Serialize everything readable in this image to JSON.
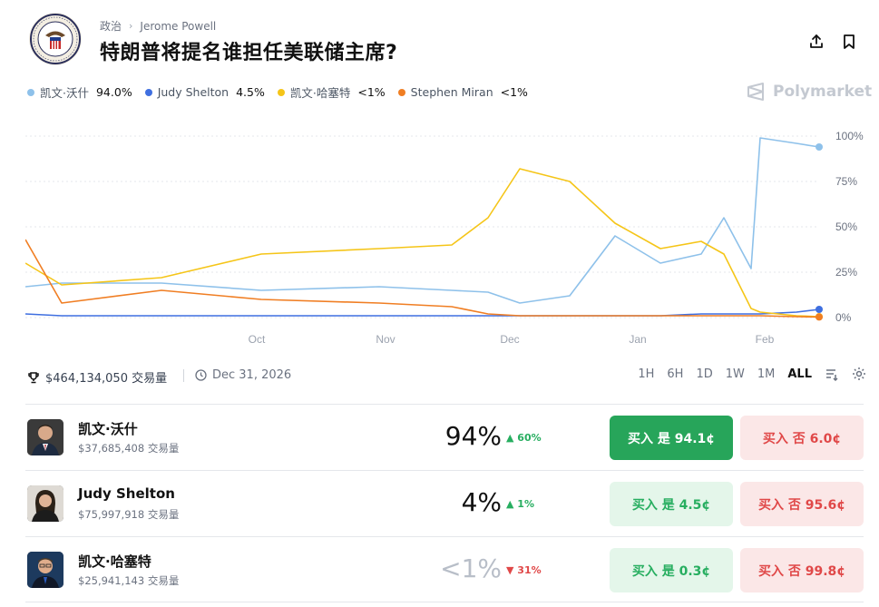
{
  "breadcrumb": {
    "category": "政治",
    "tag": "Jerome Powell"
  },
  "title": "特朗普将提名谁担任美联储主席?",
  "legend": [
    {
      "name": "凯文·沃什",
      "value": "94.0%",
      "color": "#8ec1ea"
    },
    {
      "name": "Judy Shelton",
      "value": "4.5%",
      "color": "#3f6fe0"
    },
    {
      "name": "凯文·哈塞特",
      "value": "<1%",
      "color": "#f5c518"
    },
    {
      "name": "Stephen Miran",
      "value": "<1%",
      "color": "#f07e23"
    }
  ],
  "brand": "Polymarket",
  "stats": {
    "volume": "$464,134,050 交易量",
    "end_date": "Dec 31, 2026"
  },
  "time_ranges": [
    "1H",
    "6H",
    "1D",
    "1W",
    "1M",
    "ALL"
  ],
  "active_range": "ALL",
  "chart_data": {
    "type": "line",
    "x_ticks": [
      "Oct",
      "Nov",
      "Dec",
      "Jan",
      "Feb"
    ],
    "y_ticks": [
      "0%",
      "25%",
      "50%",
      "75%",
      "100%"
    ],
    "ylim": [
      0,
      100
    ],
    "x": [
      "Sep 10",
      "Sep 25",
      "Oct 15",
      "Nov 1",
      "Nov 20",
      "Nov 28",
      "Dec 1",
      "Dec 5",
      "Dec 15",
      "Dec 22",
      "Jan 1",
      "Jan 10",
      "Jan 20",
      "Jan 28",
      "Jan 29",
      "Feb 5",
      "Feb 12"
    ],
    "series": [
      {
        "name": "凯文·沃什",
        "color": "#8ec1ea",
        "values": [
          17,
          19,
          19,
          15,
          17,
          15,
          14,
          8,
          12,
          45,
          30,
          35,
          55,
          27,
          99,
          96,
          94
        ]
      },
      {
        "name": "Judy Shelton",
        "color": "#3f6fe0",
        "values": [
          2,
          1,
          1,
          1,
          1,
          1,
          1,
          1,
          1,
          1,
          1,
          2,
          2,
          2,
          2,
          3,
          4.5
        ]
      },
      {
        "name": "凯文·哈塞特",
        "color": "#f5c518",
        "values": [
          30,
          18,
          22,
          35,
          38,
          40,
          55,
          82,
          75,
          52,
          38,
          42,
          35,
          5,
          3,
          1,
          0.5
        ]
      },
      {
        "name": "Stephen Miran",
        "color": "#f07e23",
        "values": [
          43,
          8,
          15,
          10,
          8,
          6,
          2,
          1,
          1,
          1,
          1,
          1,
          1,
          1,
          1,
          0.5,
          0.3
        ]
      }
    ]
  },
  "outcomes": [
    {
      "name": "凯文·沃什",
      "volume": "$37,685,408 交易量",
      "pct": "94%",
      "change": "▲ 60%",
      "yes": "买入 是 94.1¢",
      "no": "买入 否 6.0¢"
    },
    {
      "name": "Judy Shelton",
      "volume": "$75,997,918 交易量",
      "pct": "4%",
      "change": "▲ 1%",
      "yes": "买入 是 4.5¢",
      "no": "买入 否 95.6¢"
    },
    {
      "name": "凯文·哈塞特",
      "volume": "$25,941,143 交易量",
      "pct": "<1%",
      "change": "▼ 31%",
      "yes": "买入 是 0.3¢",
      "no": "买入 否 99.8¢"
    }
  ]
}
